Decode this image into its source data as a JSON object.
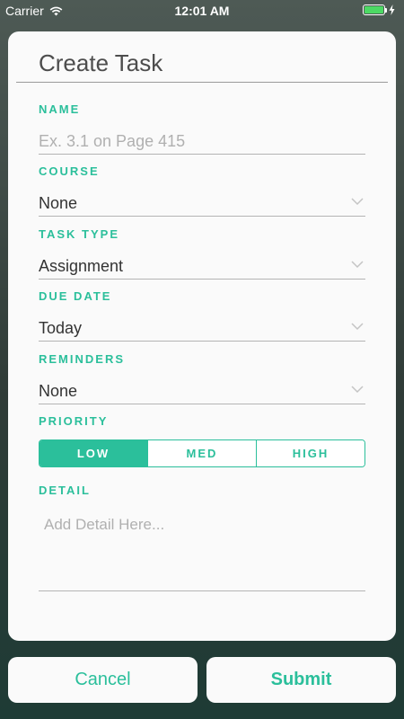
{
  "status_bar": {
    "carrier": "Carrier",
    "time": "12:01 AM",
    "battery_level": 1.0,
    "icons": [
      "wifi-icon",
      "battery-icon",
      "charging-bolt-icon"
    ]
  },
  "form": {
    "title": "Create Task",
    "name": {
      "label": "NAME",
      "placeholder": "Ex. 3.1 on Page 415",
      "value": ""
    },
    "course": {
      "label": "COURSE",
      "value": "None"
    },
    "task_type": {
      "label": "TASK TYPE",
      "value": "Assignment"
    },
    "due_date": {
      "label": "DUE DATE",
      "value": "Today"
    },
    "reminders": {
      "label": "REMINDERS",
      "value": "None"
    },
    "priority": {
      "label": "PRIORITY",
      "options": [
        "LOW",
        "MED",
        "HIGH"
      ],
      "selected": "LOW"
    },
    "detail": {
      "label": "DETAIL",
      "placeholder": "Add Detail Here..."
    }
  },
  "actions": {
    "cancel_label": "Cancel",
    "submit_label": "Submit"
  },
  "colors": {
    "accent": "#2bbf9b",
    "card": "#fafafa",
    "text": "#333333",
    "placeholder": "#b0b0b0",
    "battery": "#4cd964"
  }
}
